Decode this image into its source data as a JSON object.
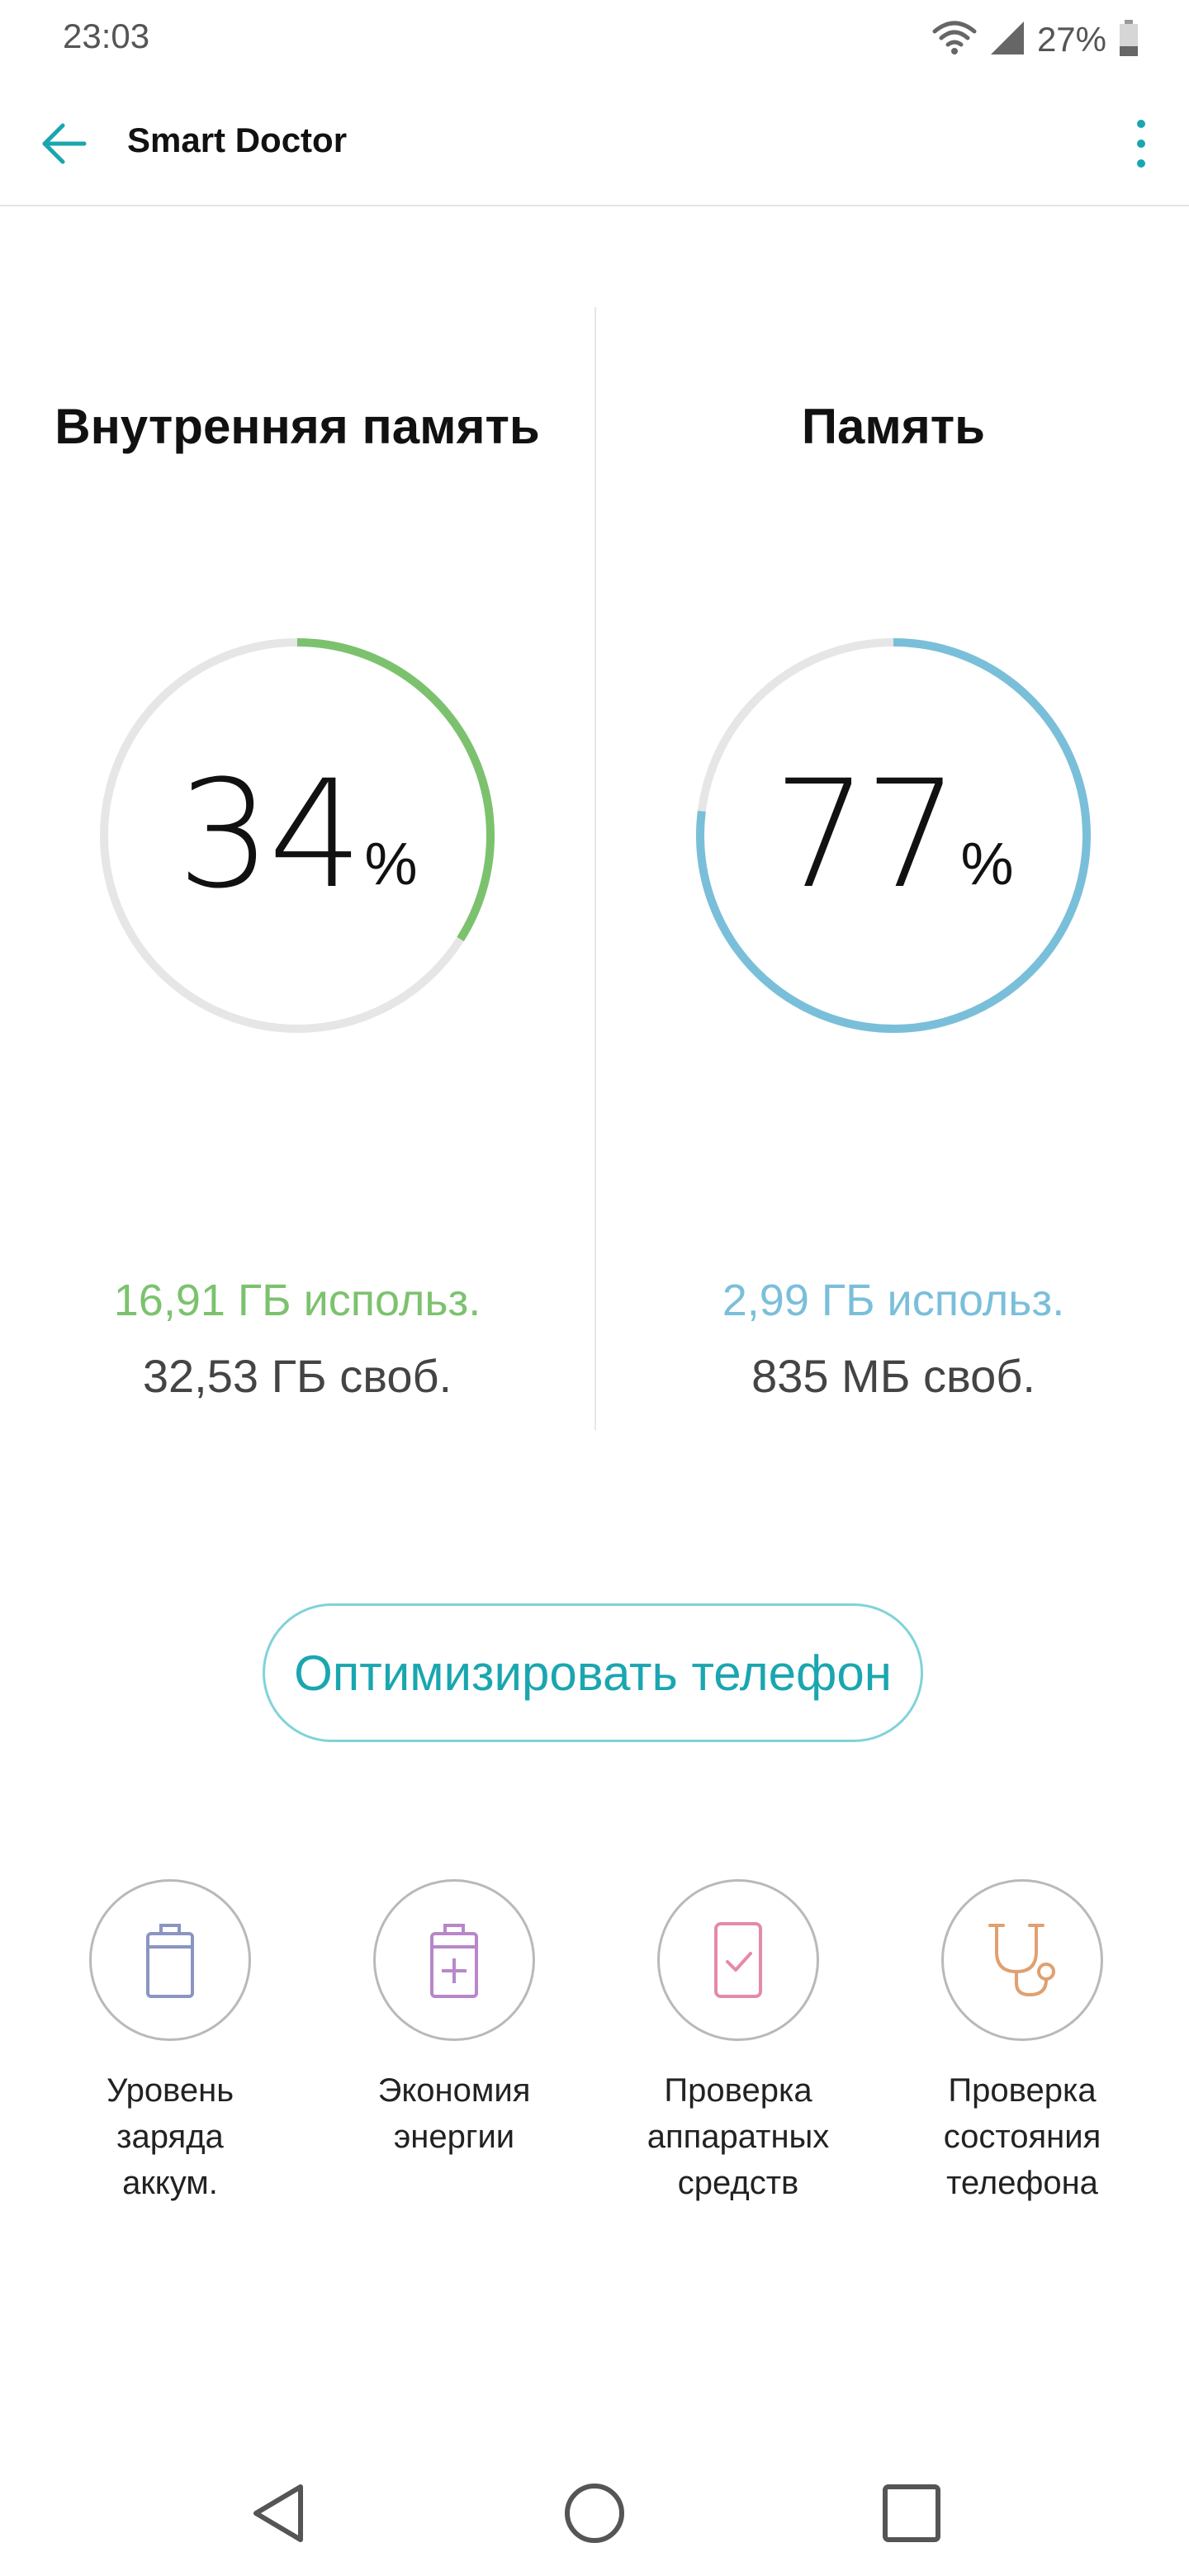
{
  "status_bar": {
    "time": "23:03",
    "battery_percent": "27%",
    "icons": [
      "wifi-icon",
      "cell-signal-icon",
      "battery-icon"
    ]
  },
  "app_bar": {
    "title": "Smart Doctor",
    "back_icon": "arrow-left-icon",
    "menu_icon": "more-vert-icon"
  },
  "meters": {
    "internal": {
      "title": "Внутренняя память",
      "percent": "34",
      "unit": "%",
      "fraction": 0.34,
      "used": "16,91 ГБ использ.",
      "free": "32,53 ГБ своб.",
      "color": "#7cc26e"
    },
    "ram": {
      "title": "Память",
      "percent": "77",
      "unit": "%",
      "fraction": 0.77,
      "used": "2,99 ГБ использ.",
      "free": "835 МБ своб.",
      "color": "#7abfda"
    }
  },
  "optimize_button": {
    "label": "Оптимизировать телефон"
  },
  "tools": [
    {
      "icon": "battery-level-icon",
      "color": "#8a95c2",
      "lines": [
        "Уровень",
        "заряда",
        "аккум."
      ]
    },
    {
      "icon": "battery-plus-icon",
      "color": "#b887c9",
      "lines": [
        "Экономия",
        "энергии"
      ]
    },
    {
      "icon": "phone-check-icon",
      "color": "#e58aa8",
      "lines": [
        "Проверка",
        "аппаратных",
        "средств"
      ]
    },
    {
      "icon": "stethoscope-icon",
      "color": "#e0a070",
      "lines": [
        "Проверка",
        "состояния",
        "телефона"
      ]
    }
  ],
  "nav_bar": {
    "icons": [
      "back-triangle-icon",
      "home-circle-icon",
      "recents-square-icon"
    ]
  },
  "colors": {
    "accent": "#1aa6b0",
    "ring_track": "#e6e6e6"
  }
}
